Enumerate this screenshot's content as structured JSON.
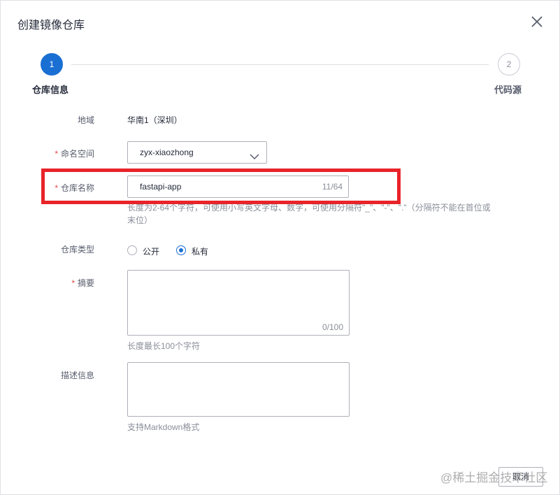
{
  "dialog": {
    "title": "创建镜像仓库"
  },
  "steps": [
    {
      "number": "1",
      "label": "仓库信息",
      "active": true
    },
    {
      "number": "2",
      "label": "代码源",
      "active": false
    }
  ],
  "form": {
    "region": {
      "label": "地域",
      "value": "华南1（深圳）"
    },
    "namespace": {
      "label": "命名空间",
      "required_mark": "*",
      "value": "zyx-xiaozhong"
    },
    "repo_name": {
      "label": "仓库名称",
      "required_mark": "*",
      "value": "fastapi-app",
      "count": "11/64",
      "hint_line1": "长度为2-64个字符，可使用小写英文字母、数字，可使用分隔符\"_\"、\"-\"、\".\"（分隔符不能在首位或",
      "hint_line2": "末位）"
    },
    "repo_type": {
      "label": "仓库类型",
      "options": [
        {
          "label": "公开",
          "checked": false
        },
        {
          "label": "私有",
          "checked": true
        }
      ]
    },
    "summary": {
      "label": "摘要",
      "required_mark": "*",
      "value": "",
      "count": "0/100",
      "hint": "长度最长100个字符"
    },
    "description": {
      "label": "描述信息",
      "value": "",
      "hint": "支持Markdown格式"
    }
  },
  "footer": {
    "cancel_label": "取消",
    "watermark": "@稀土掘金技术社区"
  },
  "colors": {
    "accent": "#1a6fd3",
    "required": "#e54545",
    "highlight_box": "#e8242a"
  }
}
